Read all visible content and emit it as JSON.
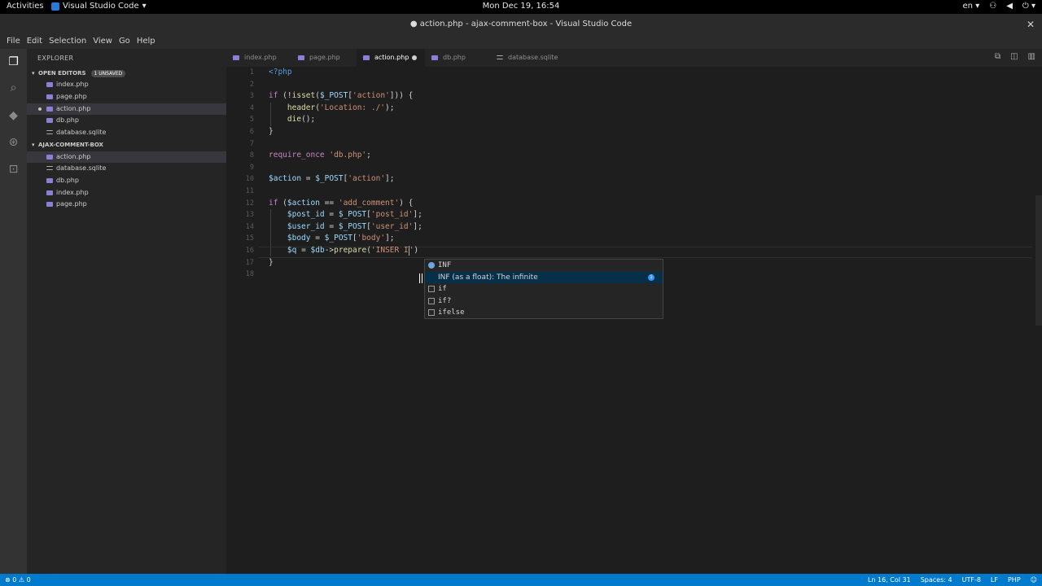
{
  "system": {
    "activities": "Activities",
    "app_name": "Visual Studio Code",
    "clock": "Mon Dec 19, 16:54",
    "lang": "en"
  },
  "window": {
    "title": "● action.php - ajax-comment-box - Visual Studio Code",
    "close": "✕"
  },
  "menu": [
    "File",
    "Edit",
    "Selection",
    "View",
    "Go",
    "Help"
  ],
  "explorer": {
    "title": "EXPLORER",
    "open_editors_label": "OPEN EDITORS",
    "unsaved_badge": "1 UNSAVED",
    "open_editors": [
      "index.php",
      "page.php",
      "action.php",
      "db.php",
      "database.sqlite"
    ],
    "project_label": "AJAX-COMMENT-BOX",
    "project_files": [
      "action.php",
      "database.sqlite",
      "db.php",
      "index.php",
      "page.php"
    ]
  },
  "tabs": [
    "index.php",
    "page.php",
    "action.php",
    "db.php",
    "database.sqlite"
  ],
  "editor": {
    "line_numbers": [
      "1",
      "2",
      "3",
      "4",
      "5",
      "6",
      "7",
      "8",
      "9",
      "10",
      "11",
      "12",
      "13",
      "14",
      "15",
      "16",
      "17",
      "18"
    ]
  },
  "suggest": {
    "item1": "INF",
    "item2": "INF (as a float): The infinite",
    "item3": "if",
    "item4": "if?",
    "item5": "ifelse"
  },
  "status": {
    "problems": "⊗ 0  ⚠ 0",
    "position": "Ln 16, Col 31",
    "spaces": "Spaces: 4",
    "encoding": "UTF-8",
    "eol": "LF",
    "language": "PHP"
  },
  "colors": {
    "statusbar": "#007acc",
    "editor_bg": "#1e1e1e",
    "sidebar_bg": "#252526",
    "keyword": "#c586c0",
    "string": "#ce9178",
    "variable": "#9cdcfe"
  }
}
